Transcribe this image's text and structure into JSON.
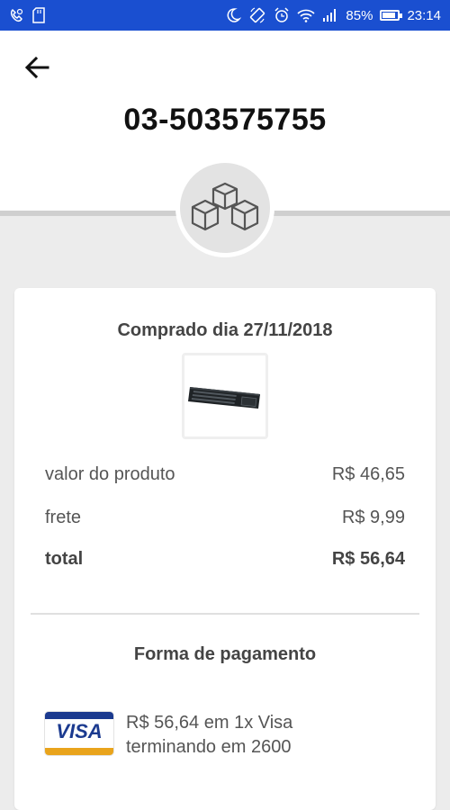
{
  "status_bar": {
    "battery_percent": "85%",
    "time": "23:14",
    "battery_level": 0.85,
    "icons_left": [
      "call-forward-icon",
      "sd-card-icon"
    ],
    "icons_right": [
      "moon-icon",
      "rotate-icon",
      "alarm-icon",
      "wifi-icon",
      "signal-icon",
      "battery-icon"
    ]
  },
  "header": {
    "order_id": "03-503575755",
    "back_icon": "arrow-left-icon",
    "badge_icon": "boxes-icon"
  },
  "order": {
    "purchase_date": "Comprado dia 27/11/2018",
    "product_image": "keyboard-icon",
    "rows": [
      {
        "label": "valor do produto",
        "value": "R$ 46,65"
      },
      {
        "label": "frete",
        "value": "R$ 9,99"
      },
      {
        "label": "total",
        "value": "R$ 56,64"
      }
    ]
  },
  "payment": {
    "title": "Forma de pagamento",
    "card_brand": "VISA",
    "description": "R$ 56,64 em 1x Visa terminando em 2600"
  },
  "colors": {
    "status_bar": "#1a4fd0",
    "page_bg": "#ececec",
    "visa_blue": "#1b3a8f",
    "visa_gold": "#e9a41c"
  }
}
